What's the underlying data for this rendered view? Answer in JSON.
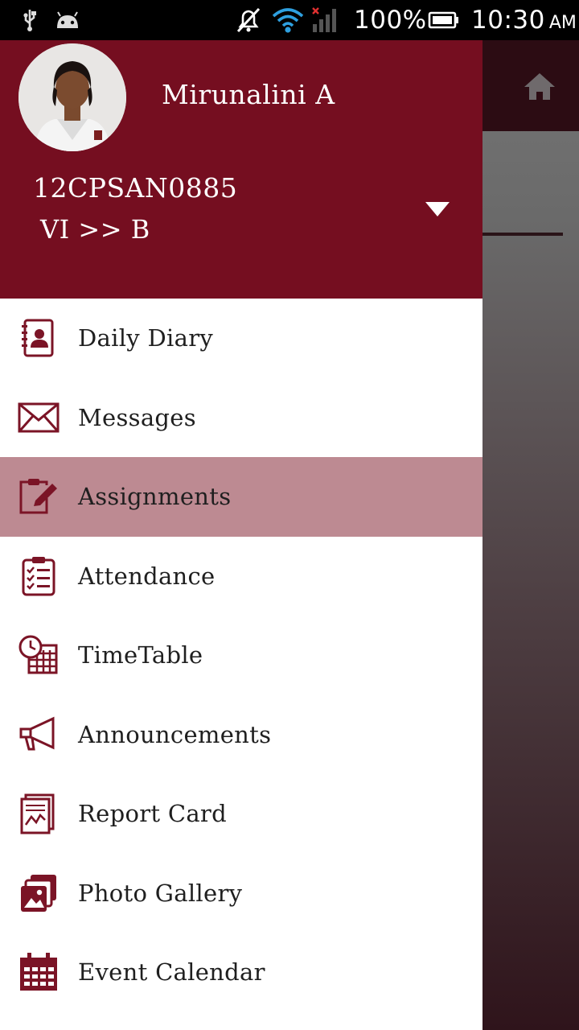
{
  "status_bar": {
    "battery": "100%",
    "time": "10:30",
    "ampm": "AM",
    "icons": [
      "usb-icon",
      "android-icon",
      "mute-icon",
      "wifi-icon",
      "no-signal-icon",
      "battery-icon"
    ]
  },
  "background_app": {
    "icons": [
      "home-icon"
    ]
  },
  "profile": {
    "name": "Mirunalini A",
    "id": "12CPSAN0885",
    "class": "VI >> B",
    "header_color": "#750e20"
  },
  "menu": {
    "active_color": "#bd8a92",
    "icon_color": "#7b1426",
    "items": [
      {
        "label": "Daily Diary",
        "icon": "diary-icon",
        "active": false
      },
      {
        "label": "Messages",
        "icon": "envelope-icon",
        "active": false
      },
      {
        "label": "Assignments",
        "icon": "assignment-edit-icon",
        "active": true
      },
      {
        "label": "Attendance",
        "icon": "checklist-icon",
        "active": false
      },
      {
        "label": "TimeTable",
        "icon": "clock-calendar-icon",
        "active": false
      },
      {
        "label": "Announcements",
        "icon": "megaphone-icon",
        "active": false
      },
      {
        "label": "Report Card",
        "icon": "report-chart-icon",
        "active": false
      },
      {
        "label": "Photo Gallery",
        "icon": "photo-gallery-icon",
        "active": false
      },
      {
        "label": "Event Calendar",
        "icon": "calendar-icon",
        "active": false
      }
    ]
  }
}
